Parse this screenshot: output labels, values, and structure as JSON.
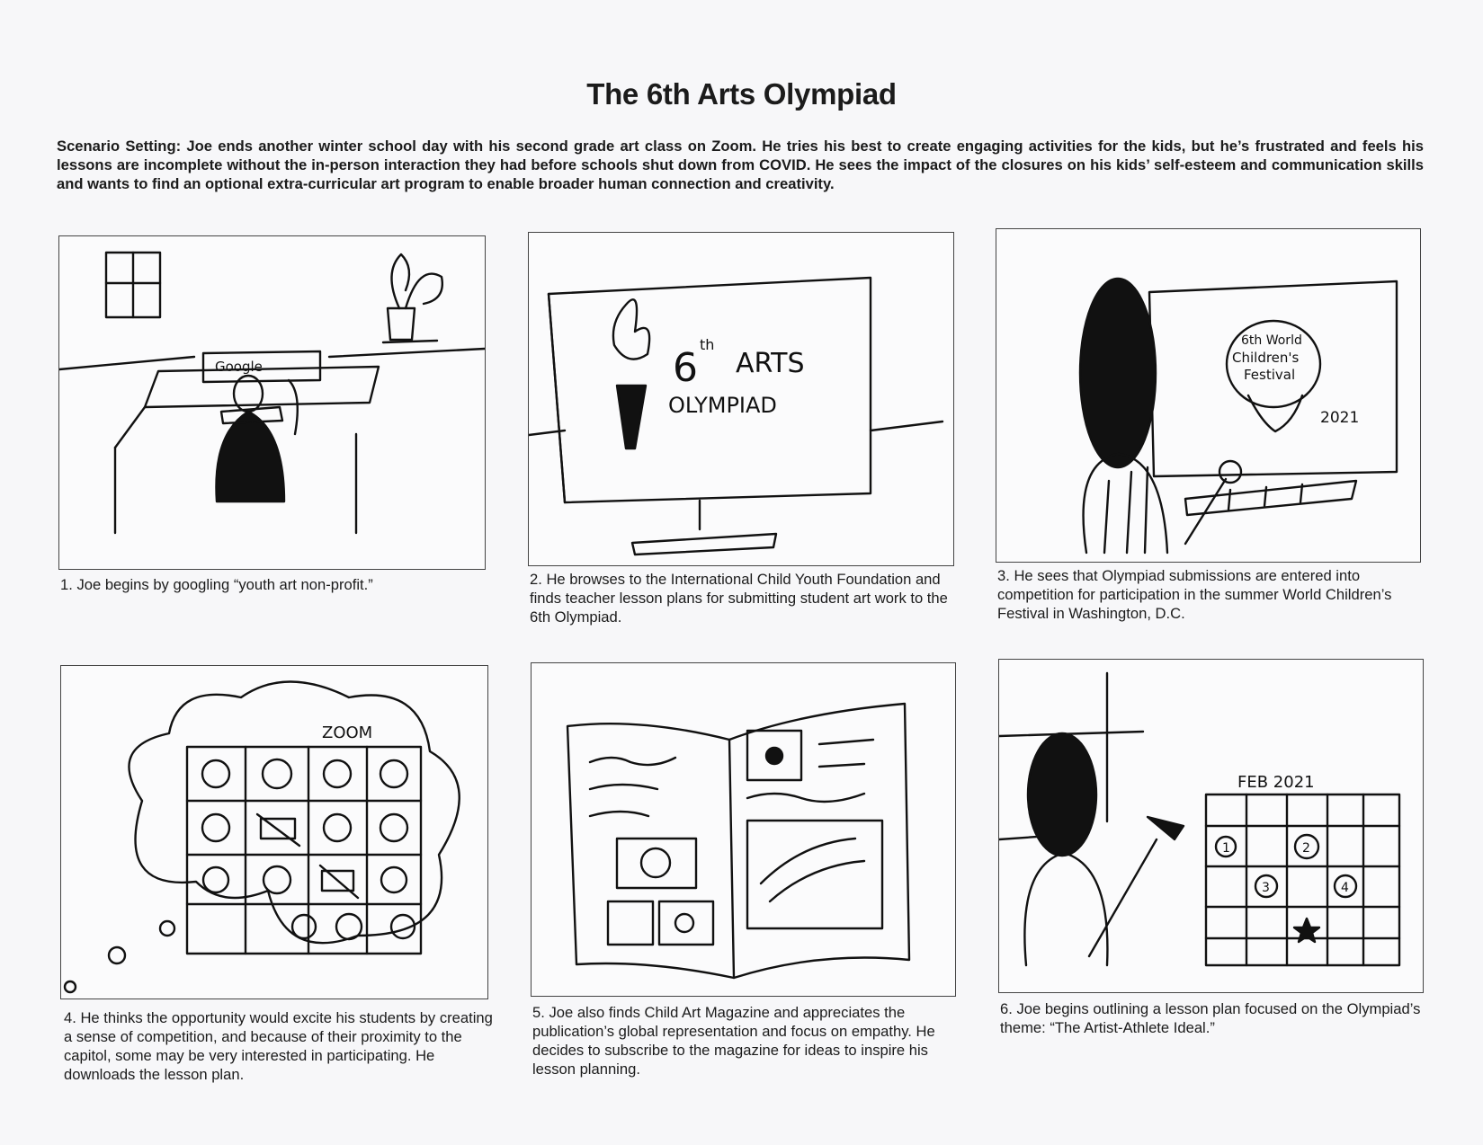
{
  "title": "The 6th Arts Olympiad",
  "scenario": {
    "label": "Scenario Setting:",
    "text": " Joe ends another winter school day with his second grade art class on Zoom. He tries his best to create engaging activities for the kids, but he’s frustrated and feels his lessons are incomplete without the in-person interaction they had before schools shut down from COVID. He sees the impact of the closures on his kids’ self-esteem and communication skills and wants to find an optional extra-curricular art program to enable broader human connection and creativity."
  },
  "panels": [
    {
      "caption": "1. Joe begins by googling “youth art non-profit.”",
      "sketch_text": [
        "Google"
      ]
    },
    {
      "caption": "2. He browses to the International Child Youth Foundation and finds teacher lesson plans for submitting student art work to the 6th Olympiad.",
      "sketch_text": [
        "6",
        "th",
        "ARTS",
        "OLYMPIAD"
      ]
    },
    {
      "caption": "3. He sees that Olympiad submissions are entered into competition for participation in the summer World Children’s Festival in Washington, D.C.",
      "sketch_text": [
        "6th World",
        "Children's",
        "Festival",
        "2021"
      ]
    },
    {
      "caption": "4. He thinks the opportunity would excite his students by creating a sense of competition, and because of their proximity to the capitol, some may be very interested in participating. He downloads the lesson plan.",
      "sketch_text": [
        "ZOOM"
      ]
    },
    {
      "caption": "5. Joe also finds Child Art Magazine and appreciates the publication’s global representation and focus on empathy. He decides to subscribe to the magazine for ideas to inspire his lesson planning.",
      "sketch_text": []
    },
    {
      "caption": "6. Joe begins outlining a lesson plan focused on the Olympiad’s theme: “The Artist-Athlete Ideal.”",
      "sketch_text": [
        "FEB 2021",
        "1",
        "2",
        "3",
        "4"
      ]
    }
  ]
}
